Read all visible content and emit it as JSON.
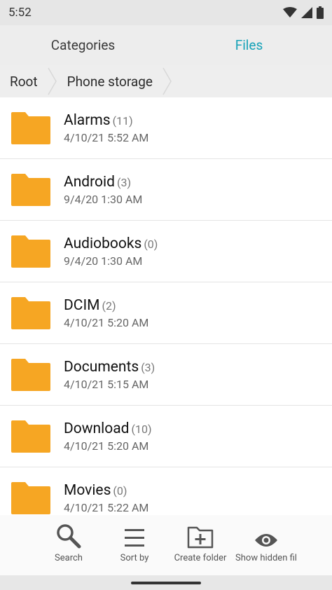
{
  "status": {
    "time": "5:52"
  },
  "tabs": [
    {
      "label": "Categories",
      "active": false
    },
    {
      "label": "Files",
      "active": true
    }
  ],
  "breadcrumb": [
    "Root",
    "Phone storage"
  ],
  "files": [
    {
      "name": "Alarms",
      "count": "(11)",
      "date": "4/10/21 5:52 AM"
    },
    {
      "name": "Android",
      "count": "(3)",
      "date": "9/4/20 1:30 AM"
    },
    {
      "name": "Audiobooks",
      "count": "(0)",
      "date": "9/4/20 1:30 AM"
    },
    {
      "name": "DCIM",
      "count": "(2)",
      "date": "4/10/21 5:20 AM"
    },
    {
      "name": "Documents",
      "count": "(3)",
      "date": "4/10/21 5:15 AM"
    },
    {
      "name": "Download",
      "count": "(10)",
      "date": "4/10/21 5:20 AM"
    },
    {
      "name": "Movies",
      "count": "(0)",
      "date": "4/10/21 5:22 AM"
    }
  ],
  "actions": [
    {
      "label": "Search",
      "icon": "search-icon"
    },
    {
      "label": "Sort by",
      "icon": "sort-icon"
    },
    {
      "label": "Create folder",
      "icon": "create-folder-icon"
    },
    {
      "label": "Show hidden fil",
      "icon": "eye-icon"
    }
  ],
  "colors": {
    "accent": "#17a2b8",
    "folder": "#f6a623"
  }
}
